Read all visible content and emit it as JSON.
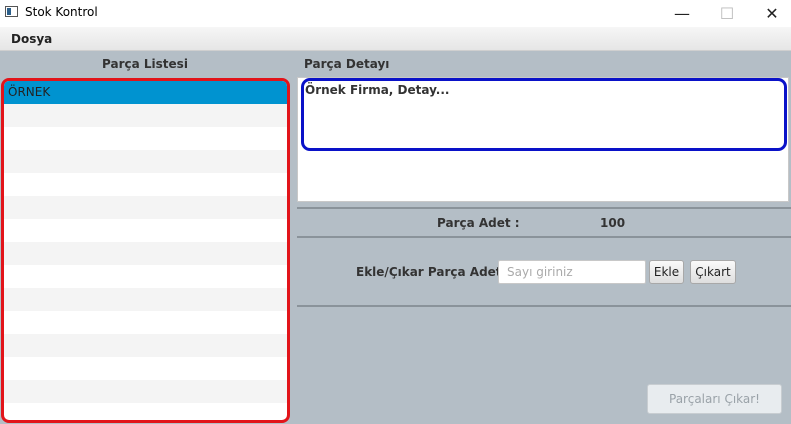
{
  "window": {
    "title": "Stok Kontrol",
    "icon": "app-window-icon",
    "controls": {
      "minimize": "—",
      "maximize": "☐",
      "close": "✕"
    }
  },
  "menubar": {
    "items": [
      {
        "label": "Dosya"
      }
    ]
  },
  "left": {
    "header": "Parça Listesi",
    "items": [
      {
        "label": "ÖRNEK",
        "selected": true
      }
    ],
    "highlight_color": "#e2141a"
  },
  "right": {
    "header": "Parça Detayı",
    "detail_text": "Örnek Firma, Detay...",
    "highlight_color": "#0a12c8",
    "count_label": "Parça Adet :",
    "count_value": "100",
    "add_remove_label": "Ekle/Çıkar Parça Adet :",
    "qty_placeholder": "Sayı giriniz",
    "add_button": "Ekle",
    "remove_button": "Çıkart",
    "bulk_button": "Parçaları Çıkar!"
  },
  "colors": {
    "selection": "#0093d0",
    "panel_bg": "#b4bec6"
  }
}
